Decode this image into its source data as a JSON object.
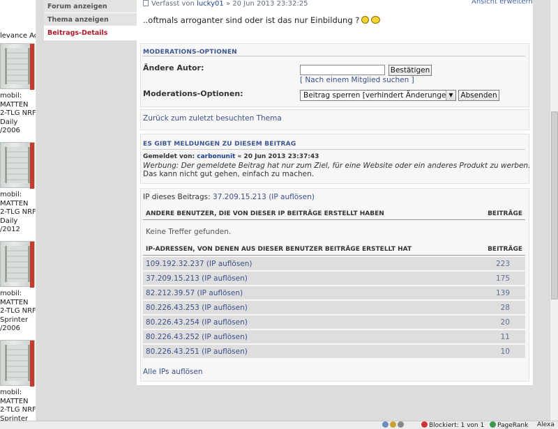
{
  "ad": {
    "title": "levance Ad",
    "boxes": [
      {
        "lines": [
          "mobil:",
          "MATTEN",
          "2-TLG NRF",
          " Daily",
          "/2006"
        ]
      },
      {
        "lines": [
          "mobil:",
          "MATTEN",
          "2-TLG NRF",
          " Daily",
          "/2012"
        ]
      },
      {
        "lines": [
          "mobil:",
          "MATTEN",
          "2-TLG NRF",
          " Sprinter",
          "/2006"
        ]
      },
      {
        "lines": [
          "mobil:",
          "MATTEN",
          "2-TLG NRF",
          " Sprinter"
        ]
      }
    ]
  },
  "nav": {
    "items": [
      {
        "label": "Forum anzeigen"
      },
      {
        "label": "Thema anzeigen"
      },
      {
        "label": "Beitrags-Details"
      }
    ]
  },
  "post": {
    "prefix": "Verfasst von",
    "author": "lucky01",
    "date": "» 20 Jun 2013 23:32:25",
    "ansicht": "Ansicht erweitern",
    "body": "..oftmals arroganter sind oder ist das nur Einbildung ?"
  },
  "moderation": {
    "title": "MODERATIONS-OPTIONEN",
    "author_label": "Ändere Autor:",
    "author_value": "",
    "confirm_btn": "Bestätigen",
    "search_member": "[ Nach einem Mitglied suchen ]",
    "options_label": "Moderations-Optionen:",
    "options_selected": "Beitrag sperren [verhindert Änderungen]",
    "submit_btn": "Absenden"
  },
  "back_link": "Zurück zum zuletzt besuchten Thema",
  "report": {
    "title": "ES GIBT MELDUNGEN ZU DIESEM BEITRAG",
    "by_label": "Gemeldet von:",
    "by_user": "carbonunit",
    "by_date": "« 20 Jun 2013 23:37:43",
    "reason": "Werbung: Der gemeldete Beitrag hat nur zum Ziel, für eine Website oder ein anderes Produkt zu werben.",
    "comment": "Das kann nicht gut gehen, einfach zu machen."
  },
  "ip": {
    "label": "IP dieses Beitrags:",
    "value": "37.209.15.213",
    "resolve": "(IP auflösen)",
    "other_users_header": "ANDERE BENUTZER, DIE VON DIESER IP BEITRÄGE ERSTELLT HABEN",
    "posts_header": "BEITRÄGE",
    "no_results": "Keine Treffer gefunden.",
    "ip_header": "IP-ADRESSEN, VON DENEN AUS DIESER BENUTZER BEITRÄGE ERSTELLT HAT",
    "rows": [
      {
        "ip": "109.192.32.237 (IP auflösen)",
        "count": "223"
      },
      {
        "ip": "37.209.15.213 (IP auflösen)",
        "count": "175"
      },
      {
        "ip": "82.212.39.57 (IP auflösen)",
        "count": "139"
      },
      {
        "ip": "80.226.43.253 (IP auflösen)",
        "count": "28"
      },
      {
        "ip": "80.226.43.254 (IP auflösen)",
        "count": "20"
      },
      {
        "ip": "80.226.43.252 (IP auflösen)",
        "count": "11"
      },
      {
        "ip": "80.226.43.251 (IP auflösen)",
        "count": "10"
      }
    ],
    "all_ips": "Alle IPs auflösen"
  },
  "status": {
    "blocked": "Blockiert: 1 von 1",
    "pagerank": "PageRank",
    "alexa": "Alexa"
  }
}
